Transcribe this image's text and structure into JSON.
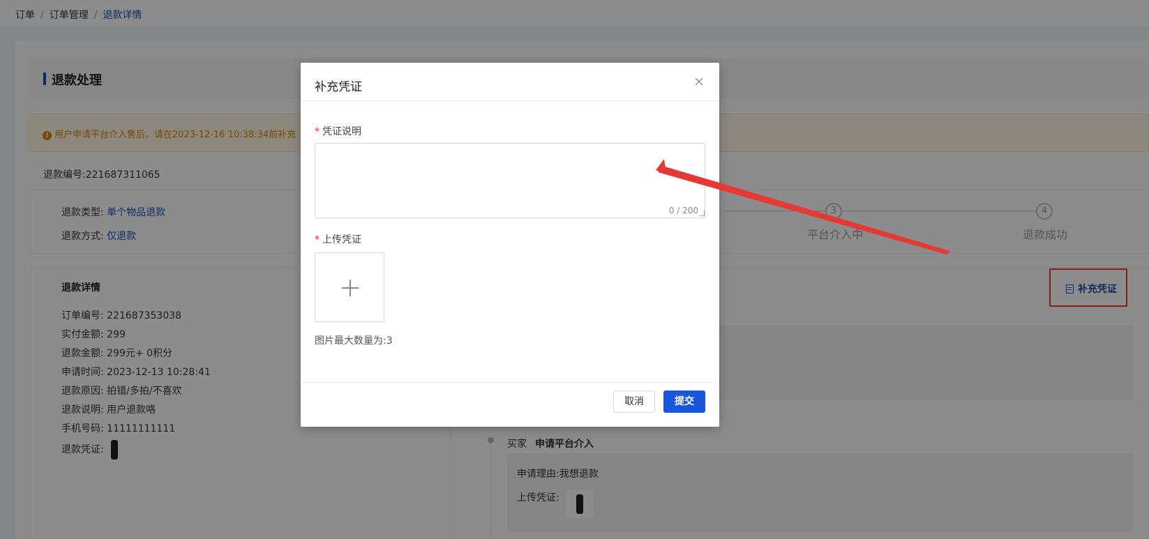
{
  "breadcrumb": {
    "item1": "订单",
    "item2": "订单管理",
    "current": "退款详情",
    "separator": "/"
  },
  "page": {
    "section_title": "退款处理",
    "alert_text": "用户申请平台介入售后，请在2023-12-16 10:38:34前补充",
    "refund_no_label": "退款编号:",
    "refund_no": "221687311065",
    "refund_type_label": "退款类型:",
    "refund_type": "单个物品退款",
    "refund_method_label": "退款方式:",
    "refund_method": "仅退款"
  },
  "steps": [
    {
      "num": "3",
      "label": "平台介入中"
    },
    {
      "num": "4",
      "label": "退款成功"
    }
  ],
  "detail": {
    "title": "退款详情",
    "rows": [
      {
        "label": "订单编号:",
        "value": "221687353038"
      },
      {
        "label": "实付金额:",
        "value": "299"
      },
      {
        "label": "退款金额:",
        "value": "299元+ 0积分"
      },
      {
        "label": "申请时间:",
        "value": "2023-12-13 10:28:41"
      },
      {
        "label": "退款原因:",
        "value": "拍错/多拍/不喜欢"
      },
      {
        "label": "退款说明:",
        "value": "用户退款咯"
      },
      {
        "label": "手机号码:",
        "value": "11111111111"
      },
      {
        "label": "退款凭证:",
        "value": ""
      }
    ]
  },
  "right_panel": {
    "supply_button": "补充凭证",
    "timeline_actor": "买家",
    "timeline_action": "申请平台介入",
    "reason_label": "申请理由:",
    "reason_value": "我想退款",
    "upload_label": "上传凭证:"
  },
  "modal": {
    "title": "补充凭证",
    "field1_label": "凭证说明",
    "field1_value": "",
    "counter": "0 / 200",
    "field2_label": "上传凭证",
    "hint": "图片最大数量为:3",
    "cancel": "取消",
    "submit": "提交",
    "required_mark": "*"
  },
  "icons": {
    "close": "close-icon",
    "plus": "plus-icon",
    "document": "document-icon",
    "warning": "warning-icon"
  },
  "colors": {
    "primary": "#1a56db",
    "link": "#1a4fb8",
    "annotation": "#e53935",
    "alert_text": "#d48806"
  }
}
